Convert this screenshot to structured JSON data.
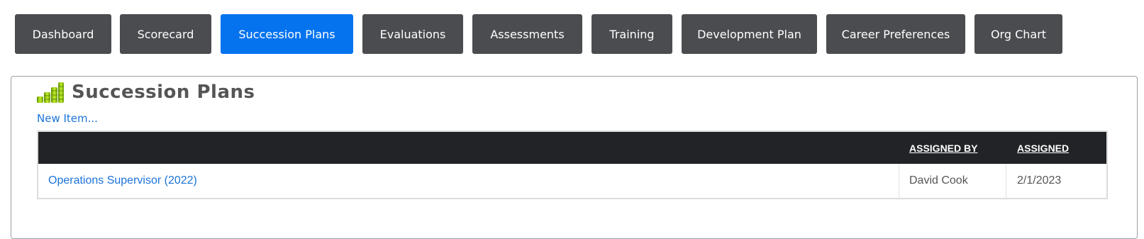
{
  "nav": {
    "tabs": [
      {
        "label": "Dashboard",
        "active": false
      },
      {
        "label": "Scorecard",
        "active": false
      },
      {
        "label": "Succession Plans",
        "active": true
      },
      {
        "label": "Evaluations",
        "active": false
      },
      {
        "label": "Assessments",
        "active": false
      },
      {
        "label": "Training",
        "active": false
      },
      {
        "label": "Development Plan",
        "active": false
      },
      {
        "label": "Career Preferences",
        "active": false
      },
      {
        "label": "Org Chart",
        "active": false
      }
    ]
  },
  "section": {
    "title": "Succession Plans",
    "icon": "bar-stack-icon",
    "new_item_label": "New Item..."
  },
  "table": {
    "columns": [
      "",
      "ASSIGNED BY",
      "ASSIGNED"
    ],
    "rows": [
      {
        "plan": "Operations Supervisor (2022)",
        "assigned_by": "David Cook",
        "assigned": "2/1/2023"
      }
    ]
  },
  "colors": {
    "tab_bg": "#4a4c50",
    "tab_active_bg": "#0573ee",
    "table_header_bg": "#212326",
    "link": "#1a73d9"
  }
}
